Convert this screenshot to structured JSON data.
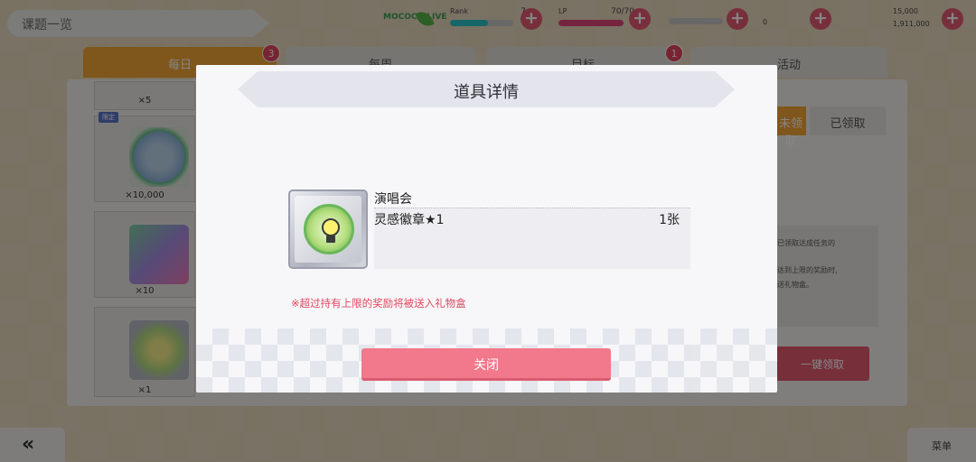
{
  "header": {
    "title": "课题一览",
    "logo_text": "MOCOCO LIVE",
    "resources": [
      {
        "label": "Rank",
        "value": "7",
        "fill": 0.6,
        "color": "#2bc3c9"
      },
      {
        "label": "LP",
        "value": "70/70",
        "fill": 1.0,
        "color": "#e0447a"
      },
      {
        "label": "",
        "value": "",
        "fill": null,
        "color": "#b9b9b9"
      }
    ],
    "coins": {
      "value1": "0",
      "value2": "15,000",
      "value3": "1,911,000"
    }
  },
  "tabs": [
    {
      "label": "每日",
      "active": true,
      "badge": "3"
    },
    {
      "label": "每周",
      "active": false,
      "badge": ""
    },
    {
      "label": "目标",
      "active": false,
      "badge": "1"
    },
    {
      "label": "活动",
      "active": false,
      "badge": ""
    }
  ],
  "list": {
    "items": [
      {
        "qty": "×5"
      },
      {
        "qty": "×10,000",
        "tag": "限定"
      },
      {
        "qty": "×10"
      },
      {
        "qty": "×1"
      }
    ],
    "segments": {
      "unclaimed": "未领取",
      "claimed": "已领取"
    },
    "desc_lines": [
      "已领取达成任务的",
      "达到上限的奖励时,",
      "送礼物盒。"
    ],
    "claim_all": "一键领取"
  },
  "footer": {
    "back": "«",
    "menu": "菜单"
  },
  "modal": {
    "title": "道具详情",
    "item_name": "演唱会",
    "reward_name": "灵感徽章★1",
    "reward_qty": "1张",
    "notice": "※超过持有上限的奖励将被送入礼物盒",
    "close_label": "关闭"
  },
  "colors": {
    "accent_orange": "#f4a534",
    "accent_pink": "#f2788b",
    "notice_red": "#e0485f"
  }
}
